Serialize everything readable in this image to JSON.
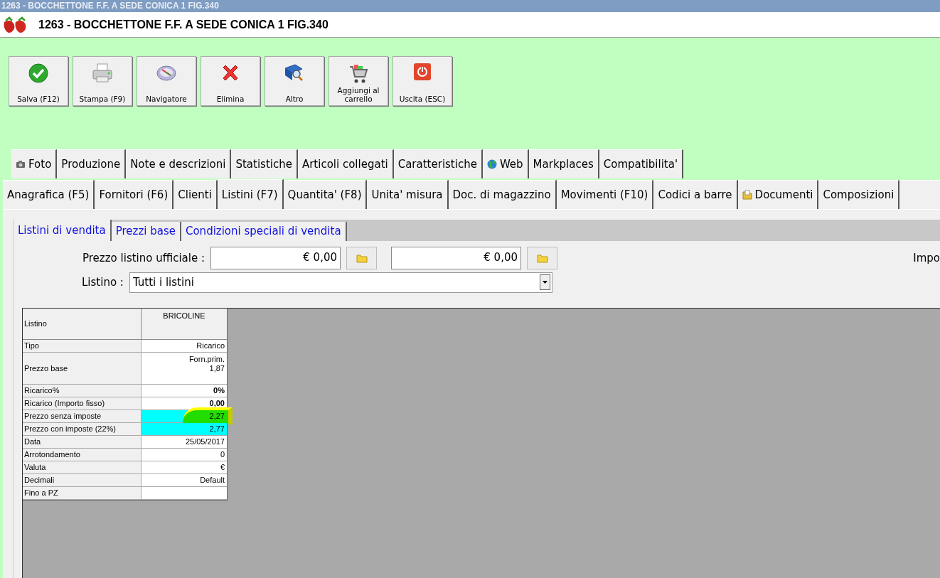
{
  "window": {
    "title": "1263 - BOCCHETTONE F.F. A SEDE CONICA 1 FIG.340"
  },
  "header": {
    "title": "1263 - BOCCHETTONE F.F. A SEDE CONICA 1 FIG.340"
  },
  "toolbar": [
    {
      "label": "Salva (F12)",
      "kind": "check"
    },
    {
      "label": "Stampa (F9)",
      "kind": "printer"
    },
    {
      "label": "Navigatore",
      "kind": "compass"
    },
    {
      "label": "Elimina",
      "kind": "cross"
    },
    {
      "label": "Altro",
      "kind": "book"
    },
    {
      "label": "Aggiungi al carrello",
      "kind": "cart"
    },
    {
      "label": "Uscita (ESC)",
      "kind": "power"
    }
  ],
  "tabs_row_1": [
    {
      "label": "Foto",
      "kind": "camera",
      "selected": false
    },
    {
      "label": "Produzione",
      "selected": false
    },
    {
      "label": "Note e descrizioni",
      "selected": false
    },
    {
      "label": "Statistiche",
      "selected": false
    },
    {
      "label": "Articoli collegati",
      "selected": false
    },
    {
      "label": "Caratteristiche",
      "selected": false
    },
    {
      "label": "Web",
      "kind": "globe",
      "selected": false
    },
    {
      "label": "Markplaces",
      "selected": false
    },
    {
      "label": "Compatibilita'",
      "selected": false
    }
  ],
  "tabs_row_2": [
    {
      "label": "Anagrafica (F5)",
      "selected": false
    },
    {
      "label": "Fornitori (F6)",
      "selected": false
    },
    {
      "label": "Clienti",
      "selected": false
    },
    {
      "label": "Listini (F7)",
      "selected": true
    },
    {
      "label": "Quantita' (F8)",
      "selected": false
    },
    {
      "label": "Unita' misura",
      "selected": false
    },
    {
      "label": "Doc. di magazzino",
      "selected": false
    },
    {
      "label": "Movimenti (F10)",
      "selected": false
    },
    {
      "label": "Codici a barre",
      "selected": false
    },
    {
      "label": "Documenti",
      "kind": "folder",
      "selected": false
    },
    {
      "label": "Composizioni",
      "selected": false
    }
  ],
  "sub_tabs": [
    {
      "label": "Listini di vendita",
      "selected": true
    },
    {
      "label": "Prezzi base",
      "selected": false
    },
    {
      "label": "Condizioni speciali di vendita",
      "selected": false
    }
  ],
  "form": {
    "price_label": "Prezzo listino ufficiale :",
    "price_values": [
      "€ 0,00",
      "€ 0,00"
    ],
    "right_label": "Impo",
    "listino_label": "Listino :",
    "listino_value": "Tutti i listini"
  },
  "grid": {
    "header": {
      "label": "Listino",
      "column": "BRICOLINE"
    },
    "rows": [
      {
        "label": "Tipo",
        "value": "Ricarico",
        "bold": false,
        "highlighted": false,
        "marked": false
      },
      {
        "label": "Prezzo base",
        "value": "Forn.prim.\n1,87",
        "bold": false,
        "highlighted": false,
        "marked": false
      },
      {
        "label": "Ricarico%",
        "value": "0%",
        "bold": true,
        "highlighted": false,
        "marked": false
      },
      {
        "label": "Ricarico (Importo fisso)",
        "value": "0,00",
        "bold": true,
        "highlighted": false,
        "marked": false
      },
      {
        "label": "Prezzo senza imposte",
        "value": "2,27",
        "bold": false,
        "highlighted": true,
        "marked": true
      },
      {
        "label": "Prezzo con imposte (22%)",
        "value": "2,77",
        "bold": false,
        "highlighted": true,
        "marked": false
      },
      {
        "label": "Data",
        "value": "25/05/2017",
        "bold": false,
        "highlighted": false,
        "marked": false
      },
      {
        "label": "Arrotondamento",
        "value": "0",
        "bold": false,
        "highlighted": false,
        "marked": false
      },
      {
        "label": "Valuta",
        "value": "€",
        "bold": false,
        "highlighted": false,
        "marked": false
      },
      {
        "label": "Decimali",
        "value": "Default",
        "bold": false,
        "highlighted": false,
        "marked": false
      },
      {
        "label": "Fino a PZ",
        "value": "",
        "highlighted": false,
        "marked": false
      }
    ]
  }
}
